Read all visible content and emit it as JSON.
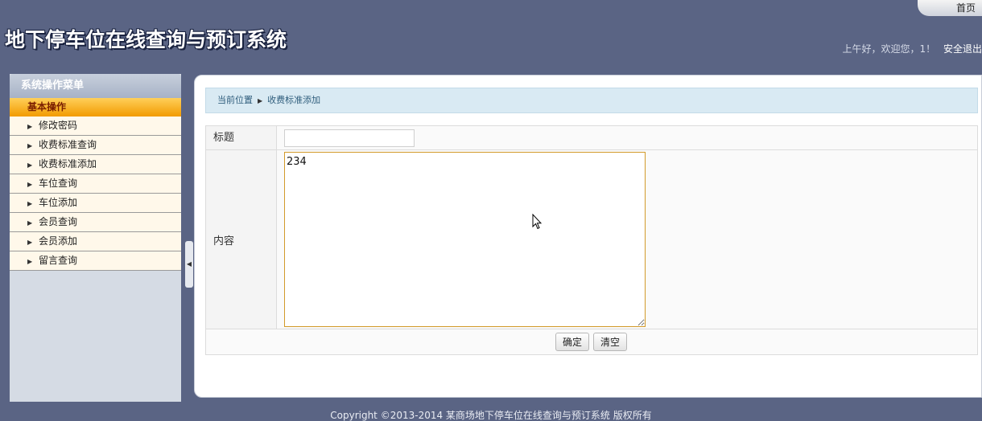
{
  "header": {
    "site_title": "地下停车位在线查询与预订系统",
    "home_link": "首页",
    "greeting": "上午好，欢迎您，1！",
    "logout_link": "安全退出"
  },
  "sidebar": {
    "title": "系统操作菜单",
    "section": "基本操作",
    "items": [
      {
        "label": "修改密码"
      },
      {
        "label": "收费标准查询"
      },
      {
        "label": "收费标准添加"
      },
      {
        "label": "车位查询"
      },
      {
        "label": "车位添加"
      },
      {
        "label": "会员查询"
      },
      {
        "label": "会员添加"
      },
      {
        "label": "留言查询"
      }
    ]
  },
  "breadcrumb": {
    "current_label": "当前位置",
    "page": "收费标准添加"
  },
  "form": {
    "title_label": "标题",
    "title_value": "",
    "content_label": "内容",
    "content_value": "234",
    "confirm_label": "确定",
    "clear_label": "清空"
  },
  "footer": {
    "copyright": "Copyright ©2013-2014 某商场地下停车位在线查询与预订系统 版权所有"
  }
}
